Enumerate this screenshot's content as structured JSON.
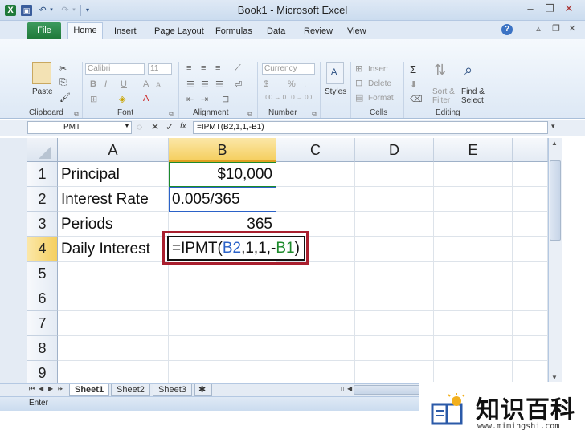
{
  "window": {
    "title": "Book1 - Microsoft Excel",
    "minimize": "–",
    "restore": "❐",
    "close": "✕"
  },
  "qat": {
    "app_icon": "X",
    "undo_glyph": "↶",
    "redo_glyph": "↷",
    "dropdown_glyph": "▾",
    "customize_glyph": "▾"
  },
  "ribbon_tabs": {
    "file": "File",
    "tabs": [
      {
        "label": "Home",
        "selected": true
      },
      {
        "label": "Insert"
      },
      {
        "label": "Page Layout"
      },
      {
        "label": "Formulas"
      },
      {
        "label": "Data"
      },
      {
        "label": "Review"
      },
      {
        "label": "View"
      }
    ],
    "help": "?"
  },
  "ribbon": {
    "clipboard": {
      "paste": "Paste",
      "label": "Clipboard"
    },
    "font": {
      "font_name": "Calibri",
      "font_size": "11",
      "bold": "B",
      "italic": "I",
      "underline": "U",
      "grow": "A",
      "shrink": "A",
      "font_color": "A",
      "label": "Font"
    },
    "alignment": {
      "label": "Alignment"
    },
    "number": {
      "format": "Currency",
      "currency_symbol": "$",
      "percent": "%",
      "comma": ",",
      "inc_decimal": ".00 →.0",
      "dec_decimal": ".0 →.00",
      "label": "Number"
    },
    "styles": {
      "label": "Styles"
    },
    "cells": {
      "insert": "Insert",
      "delete": "Delete",
      "format": "Format",
      "label": "Cells"
    },
    "editing": {
      "sum": "Σ",
      "sort_filter": "Sort & Filter",
      "find_select": "Find & Select",
      "label": "Editing"
    }
  },
  "formula_bar": {
    "name_box": "PMT",
    "cancel": "✕",
    "enter": "✓",
    "fx": "fx",
    "formula": "=IPMT(B2,1,1,-B1)"
  },
  "grid": {
    "columns": [
      "A",
      "B",
      "C",
      "D",
      "E"
    ],
    "selected_column": "B",
    "rows": [
      "1",
      "2",
      "3",
      "4",
      "5",
      "6",
      "7",
      "8",
      "9"
    ],
    "selected_row": "4",
    "cells": {
      "A1": "Principal",
      "B1": "$10,000",
      "A2": "Interest Rate",
      "B2": "0.005/365",
      "A3": "Periods",
      "B3": "365",
      "A4": "Daily Interest"
    },
    "active_cell": {
      "address": "B4",
      "parts": [
        "=IPMT(",
        "B2",
        ",1,1,-",
        "B1",
        ")"
      ]
    }
  },
  "sheets": {
    "tabs": [
      "Sheet1",
      "Sheet2",
      "Sheet3"
    ],
    "active": "Sheet1"
  },
  "status": {
    "mode": "Enter"
  },
  "watermark": {
    "title": "知识百科",
    "url": "www.mimingshi.com"
  },
  "colors": {
    "excel_green": "#1f7a3a",
    "highlight_red": "#a91f2e",
    "ref_blue": "#2b62c8",
    "ref_green": "#1c8a2a",
    "header_selected": "#f5cf5f"
  }
}
